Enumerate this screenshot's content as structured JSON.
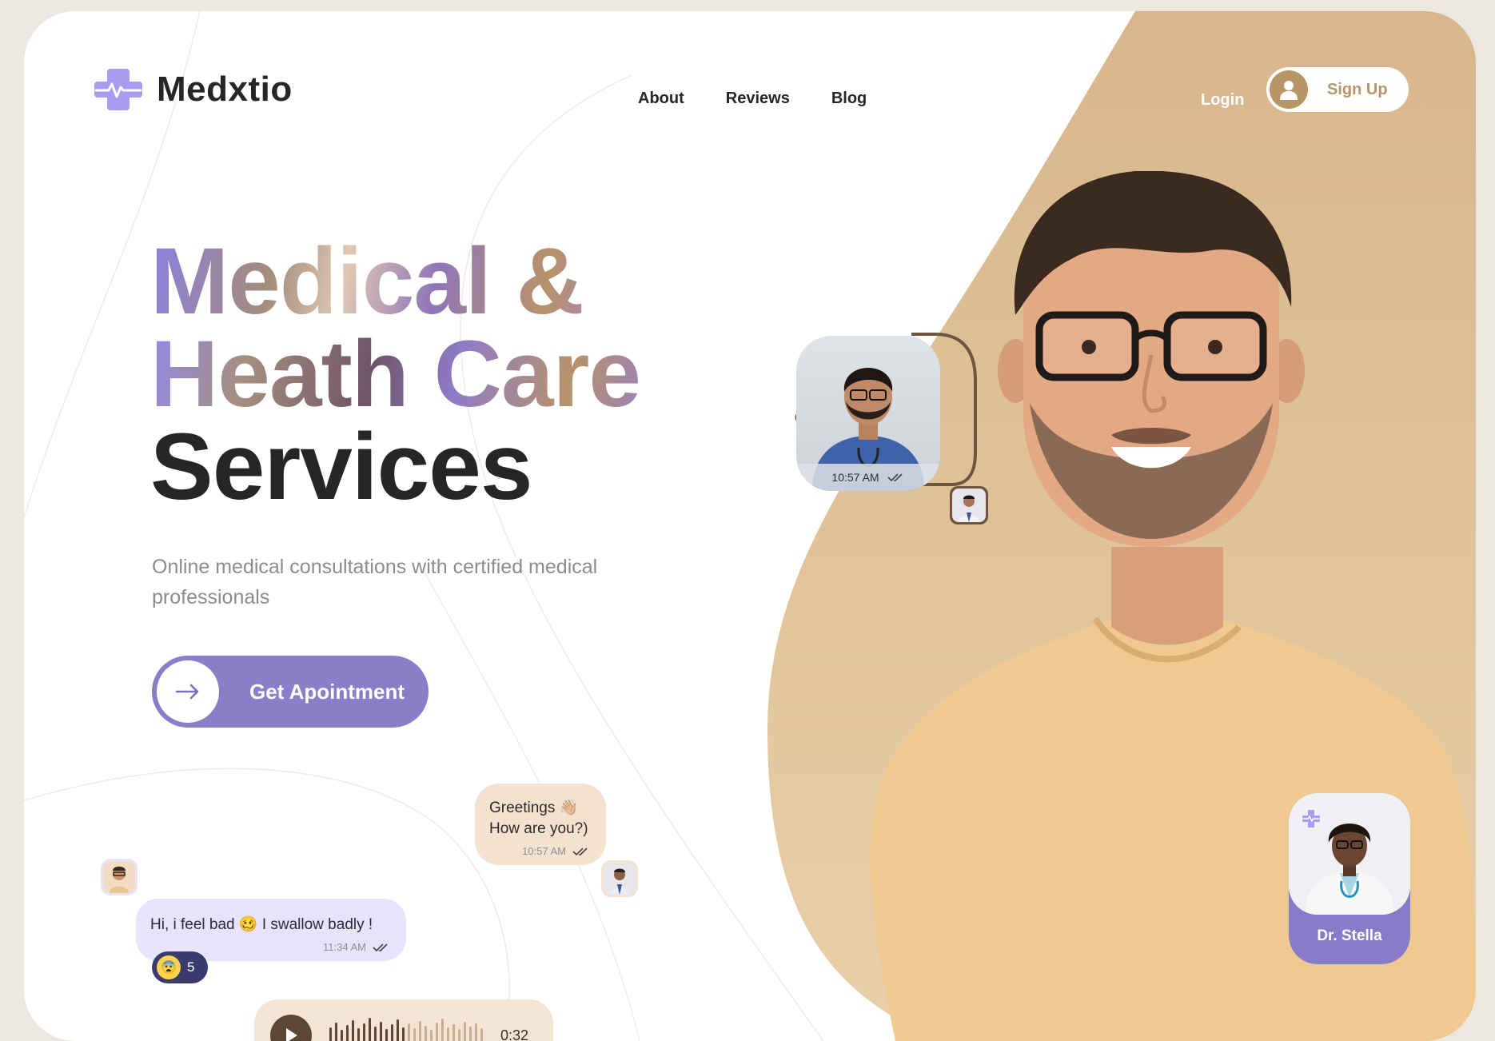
{
  "brand": {
    "name": "Medxtio",
    "icon": "medical-cross-pulse-icon",
    "accent": "#8b7ec9",
    "tan": "#e0c299"
  },
  "nav": {
    "items": [
      {
        "label": "About"
      },
      {
        "label": "Reviews"
      },
      {
        "label": "Blog"
      }
    ]
  },
  "auth": {
    "login_label": "Login",
    "signup_label": "Sign Up",
    "signup_icon": "user-icon"
  },
  "hero": {
    "title_line1": "Medical &",
    "title_line2": "Heath Care",
    "title_line3": "Services",
    "subtitle": "Online medical consultations with certified medical professionals",
    "cta_label": "Get Apointment",
    "cta_icon": "arrow-right-icon"
  },
  "video_call": {
    "time": "10:57 AM",
    "status_icon": "double-check-icon"
  },
  "chat": {
    "greeting": {
      "line1": "Greetings 👋🏼",
      "line2": "How are you?)",
      "time": "10:57 AM"
    },
    "message": {
      "text": "Hi, i feel bad 🥴 I swallow badly !",
      "time": "11:34 AM"
    },
    "reaction": {
      "emoji": "😨",
      "count": "5"
    },
    "voice": {
      "duration": "0:32",
      "icon": "play-icon"
    }
  },
  "doctor_card": {
    "name": "Dr. Stella",
    "icon": "medical-cross-icon"
  }
}
